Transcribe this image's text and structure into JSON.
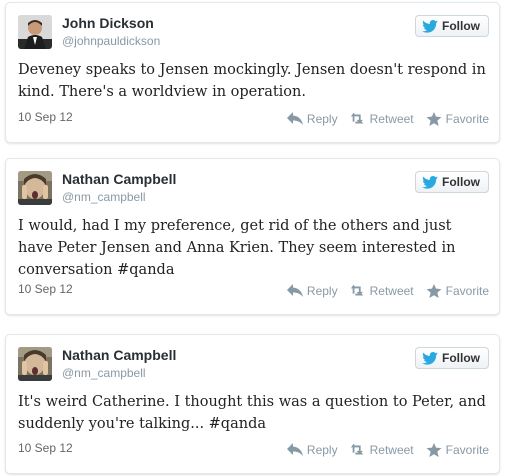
{
  "tweets": [
    {
      "name": "John Dickson",
      "handle": "@johnpauldickson",
      "follow_label": "Follow",
      "text": "Deveney speaks to Jensen mockingly. Jensen doesn't respond in kind. There's a worldview in operation.",
      "date": "10 Sep 12",
      "reply_label": "Reply",
      "retweet_label": "Retweet",
      "favorite_label": "Favorite"
    },
    {
      "name": "Nathan Campbell",
      "handle": "@nm_campbell",
      "follow_label": "Follow",
      "text": "I would, had I my preference, get rid of the others and just have Peter Jensen and Anna Krien. They seem interested in conversation #qanda",
      "date": "10 Sep 12",
      "reply_label": "Reply",
      "retweet_label": "Retweet",
      "favorite_label": "Favorite"
    },
    {
      "name": "Nathan Campbell",
      "handle": "@nm_campbell",
      "follow_label": "Follow",
      "text": "It's weird Catherine. I thought this was a question to Peter, and suddenly you're talking... #qanda",
      "date": "10 Sep 12",
      "reply_label": "Reply",
      "retweet_label": "Retweet",
      "favorite_label": "Favorite"
    }
  ],
  "colors": {
    "twitter_blue": "#2aa9e0",
    "action_gray": "#8899a6",
    "name_color": "#292f33"
  },
  "icons": [
    "twitter-bird-icon",
    "reply-icon",
    "retweet-icon",
    "favorite-icon"
  ]
}
